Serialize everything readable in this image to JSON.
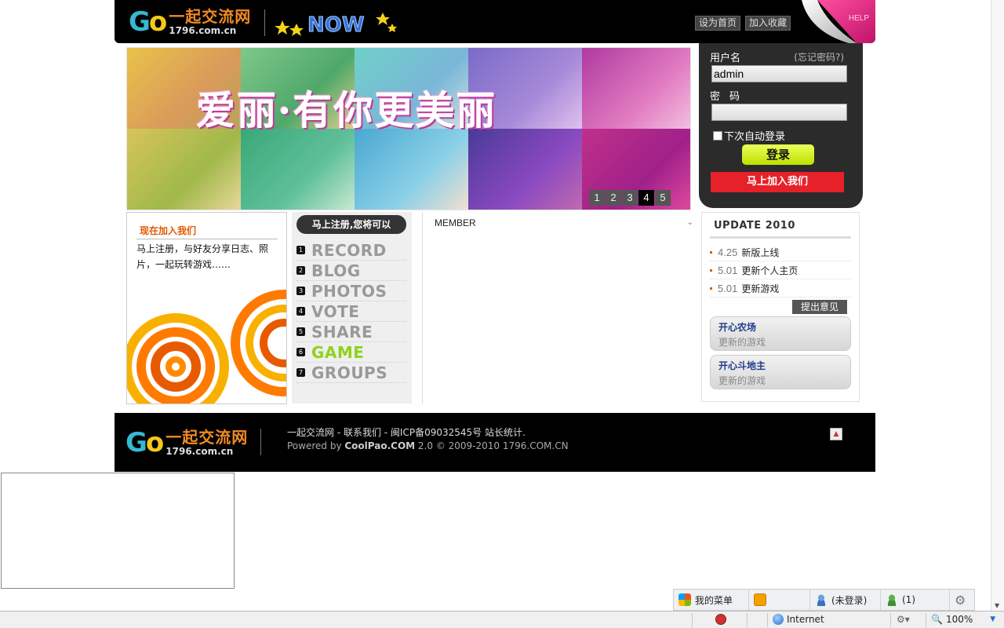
{
  "header": {
    "logo_go": "Go",
    "logo_cn": "一起交流网",
    "logo_domain": "1796.com.cn",
    "badge": "NOW",
    "set_home": "设为首页",
    "add_favorite": "加入收藏",
    "help": "HELP"
  },
  "banner": {
    "title": "爱丽·有你更美丽",
    "pages": [
      "1",
      "2",
      "3",
      "4",
      "5"
    ],
    "active_page": "4"
  },
  "login": {
    "username_label": "用户名",
    "forgot": "(忘记密码?)",
    "username_value": "admin",
    "password_label": "密码",
    "password_value": "",
    "remember": "下次自动登录",
    "login_button": "登录",
    "join_button": "马上加入我们"
  },
  "join_box": {
    "title": "现在加入我们",
    "desc": "马上注册，与好友分享日志、照片，一起玩转游戏……"
  },
  "features": {
    "head": "马上注册,您将可以",
    "items": [
      {
        "num": "1",
        "name": "RECORD"
      },
      {
        "num": "2",
        "name": "BLOG"
      },
      {
        "num": "3",
        "name": "PHOTOS"
      },
      {
        "num": "4",
        "name": "VOTE"
      },
      {
        "num": "5",
        "name": "SHARE"
      },
      {
        "num": "6",
        "name": "GAME",
        "highlight": true
      },
      {
        "num": "7",
        "name": "GROUPS"
      }
    ]
  },
  "member": {
    "title": "MEMBER"
  },
  "update": {
    "title": "UPDATE 2010",
    "items": [
      {
        "date": "4.25",
        "text": "新版上线"
      },
      {
        "date": "5.01",
        "text": "更新个人主页"
      },
      {
        "date": "5.01",
        "text": "更新游戏"
      }
    ],
    "feedback": "提出意见",
    "games": [
      {
        "name": "开心农场",
        "desc": "更新的游戏"
      },
      {
        "name": "开心斗地主",
        "desc": "更新的游戏"
      }
    ]
  },
  "footer": {
    "line1": "一起交流网 - 联系我们 - 闽ICP备09032545号 站长统计.",
    "powered_pre": "Powered by ",
    "powered_brand": "CoolPao.COM",
    "powered_post": " 2.0 © 2009-2010 1796.COM.CN"
  },
  "toolbar": {
    "menu": "我的菜单",
    "not_logged": "(未登录)",
    "count": "(1)"
  },
  "statusbar": {
    "zone": "Internet",
    "zoom": "100%"
  },
  "colors": {
    "accent_orange": "#e05a00",
    "join_red": "#e62129",
    "login_green": "#bde000",
    "game_green": "#8fd21a"
  }
}
